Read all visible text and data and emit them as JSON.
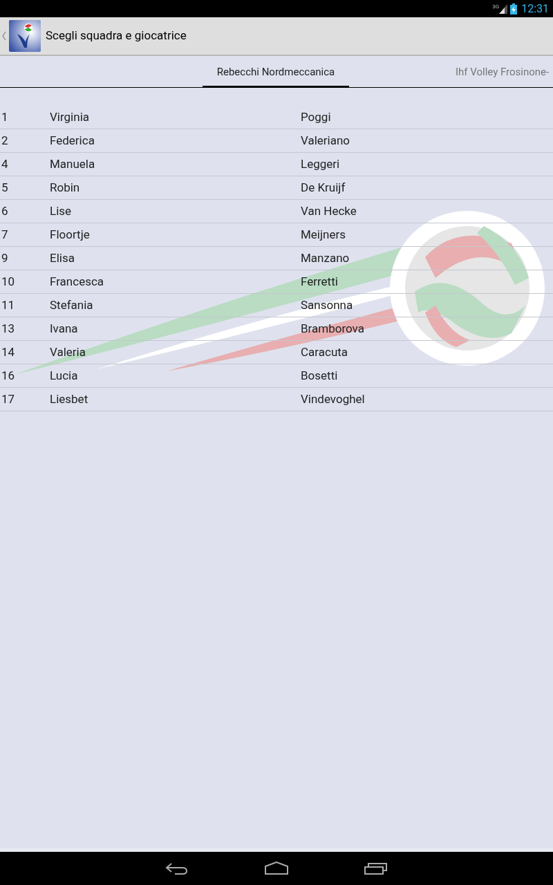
{
  "status_bar": {
    "network": "3G",
    "time": "12:31"
  },
  "app_bar": {
    "title": "Scegli squadra e giocatrice"
  },
  "tabs": [
    {
      "label": "Rebecchi Nordmeccanica",
      "selected": true
    },
    {
      "label": "Ihf Volley Frosinone-",
      "selected": false
    }
  ],
  "players": [
    {
      "number": "1",
      "first_name": "Virginia",
      "last_name": "Poggi"
    },
    {
      "number": "2",
      "first_name": "Federica",
      "last_name": "Valeriano"
    },
    {
      "number": "4",
      "first_name": "Manuela",
      "last_name": "Leggeri"
    },
    {
      "number": "5",
      "first_name": "Robin",
      "last_name": "De Kruijf"
    },
    {
      "number": "6",
      "first_name": "Lise",
      "last_name": "Van Hecke"
    },
    {
      "number": "7",
      "first_name": "Floortje",
      "last_name": "Meijners"
    },
    {
      "number": "9",
      "first_name": "Elisa",
      "last_name": "Manzano"
    },
    {
      "number": "10",
      "first_name": "Francesca",
      "last_name": "Ferretti"
    },
    {
      "number": "11",
      "first_name": "Stefania",
      "last_name": "Sansonna"
    },
    {
      "number": "13",
      "first_name": "Ivana",
      "last_name": "Bramborova"
    },
    {
      "number": "14",
      "first_name": "Valeria",
      "last_name": "Caracuta"
    },
    {
      "number": "16",
      "first_name": "Lucia",
      "last_name": "Bosetti"
    },
    {
      "number": "17",
      "first_name": "Liesbet",
      "last_name": "Vindevoghel"
    }
  ]
}
